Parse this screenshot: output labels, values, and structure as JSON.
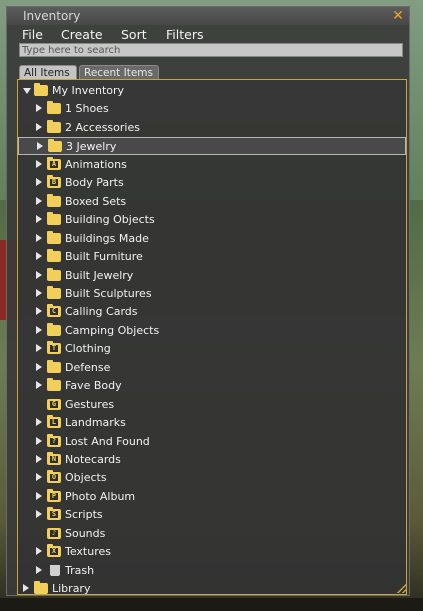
{
  "window": {
    "title": "Inventory",
    "close_symbol": "✕"
  },
  "menu": [
    "File",
    "Create",
    "Sort",
    "Filters"
  ],
  "search": {
    "placeholder": "Type here to search",
    "value": ""
  },
  "tabs": [
    {
      "label": "All Items",
      "active": true
    },
    {
      "label": "Recent Items",
      "active": false
    }
  ],
  "tree": [
    {
      "label": "My Inventory",
      "level": 0,
      "arrow": "down",
      "icon": "folder-icon",
      "badge": ""
    },
    {
      "label": "1 Shoes",
      "level": 1,
      "arrow": "right",
      "icon": "folder-icon",
      "badge": ""
    },
    {
      "label": "2 Accessories",
      "level": 1,
      "arrow": "right",
      "icon": "folder-icon",
      "badge": ""
    },
    {
      "label": "3 Jewelry",
      "level": 1,
      "arrow": "right",
      "icon": "folder-icon",
      "badge": "",
      "selected": true
    },
    {
      "label": "Animations",
      "level": 1,
      "arrow": "right",
      "icon": "animations-folder-icon",
      "badge": "A"
    },
    {
      "label": "Body Parts",
      "level": 1,
      "arrow": "right",
      "icon": "body-parts-folder-icon",
      "badge": "B"
    },
    {
      "label": "Boxed Sets",
      "level": 1,
      "arrow": "right",
      "icon": "folder-icon",
      "badge": ""
    },
    {
      "label": "Building Objects",
      "level": 1,
      "arrow": "right",
      "icon": "folder-icon",
      "badge": ""
    },
    {
      "label": "Buildings Made",
      "level": 1,
      "arrow": "right",
      "icon": "folder-icon",
      "badge": ""
    },
    {
      "label": "Built Furniture",
      "level": 1,
      "arrow": "right",
      "icon": "folder-icon",
      "badge": ""
    },
    {
      "label": "Built Jewelry",
      "level": 1,
      "arrow": "right",
      "icon": "folder-icon",
      "badge": ""
    },
    {
      "label": "Built Sculptures",
      "level": 1,
      "arrow": "right",
      "icon": "folder-icon",
      "badge": ""
    },
    {
      "label": "Calling Cards",
      "level": 1,
      "arrow": "right",
      "icon": "calling-cards-folder-icon",
      "badge": "C"
    },
    {
      "label": "Camping Objects",
      "level": 1,
      "arrow": "right",
      "icon": "folder-icon",
      "badge": ""
    },
    {
      "label": "Clothing",
      "level": 1,
      "arrow": "right",
      "icon": "clothing-folder-icon",
      "badge": "T"
    },
    {
      "label": "Defense",
      "level": 1,
      "arrow": "right",
      "icon": "folder-icon",
      "badge": ""
    },
    {
      "label": "Fave Body",
      "level": 1,
      "arrow": "right",
      "icon": "folder-icon",
      "badge": ""
    },
    {
      "label": "Gestures",
      "level": 1,
      "arrow": "none",
      "icon": "gestures-icon",
      "badge": "G"
    },
    {
      "label": "Landmarks",
      "level": 1,
      "arrow": "right",
      "icon": "landmarks-folder-icon",
      "badge": "L"
    },
    {
      "label": "Lost And Found",
      "level": 1,
      "arrow": "right",
      "icon": "lost-and-found-folder-icon",
      "badge": "?"
    },
    {
      "label": "Notecards",
      "level": 1,
      "arrow": "right",
      "icon": "notecards-folder-icon",
      "badge": "N"
    },
    {
      "label": "Objects",
      "level": 1,
      "arrow": "right",
      "icon": "objects-folder-icon",
      "badge": "O"
    },
    {
      "label": "Photo Album",
      "level": 1,
      "arrow": "right",
      "icon": "photo-album-folder-icon",
      "badge": "P"
    },
    {
      "label": "Scripts",
      "level": 1,
      "arrow": "right",
      "icon": "scripts-folder-icon",
      "badge": "S"
    },
    {
      "label": "Sounds",
      "level": 1,
      "arrow": "none",
      "icon": "sounds-icon",
      "badge": "♪"
    },
    {
      "label": "Textures",
      "level": 1,
      "arrow": "right",
      "icon": "textures-folder-icon",
      "badge": "X"
    },
    {
      "label": "Trash",
      "level": 1,
      "arrow": "right",
      "icon": "trash-icon",
      "badge": ""
    },
    {
      "label": "Library",
      "level": 0,
      "arrow": "right",
      "icon": "folder-icon",
      "badge": ""
    }
  ],
  "colors": {
    "folder": "#f2cf59",
    "accent_border": "#c9a437",
    "close": "#f0a020"
  }
}
